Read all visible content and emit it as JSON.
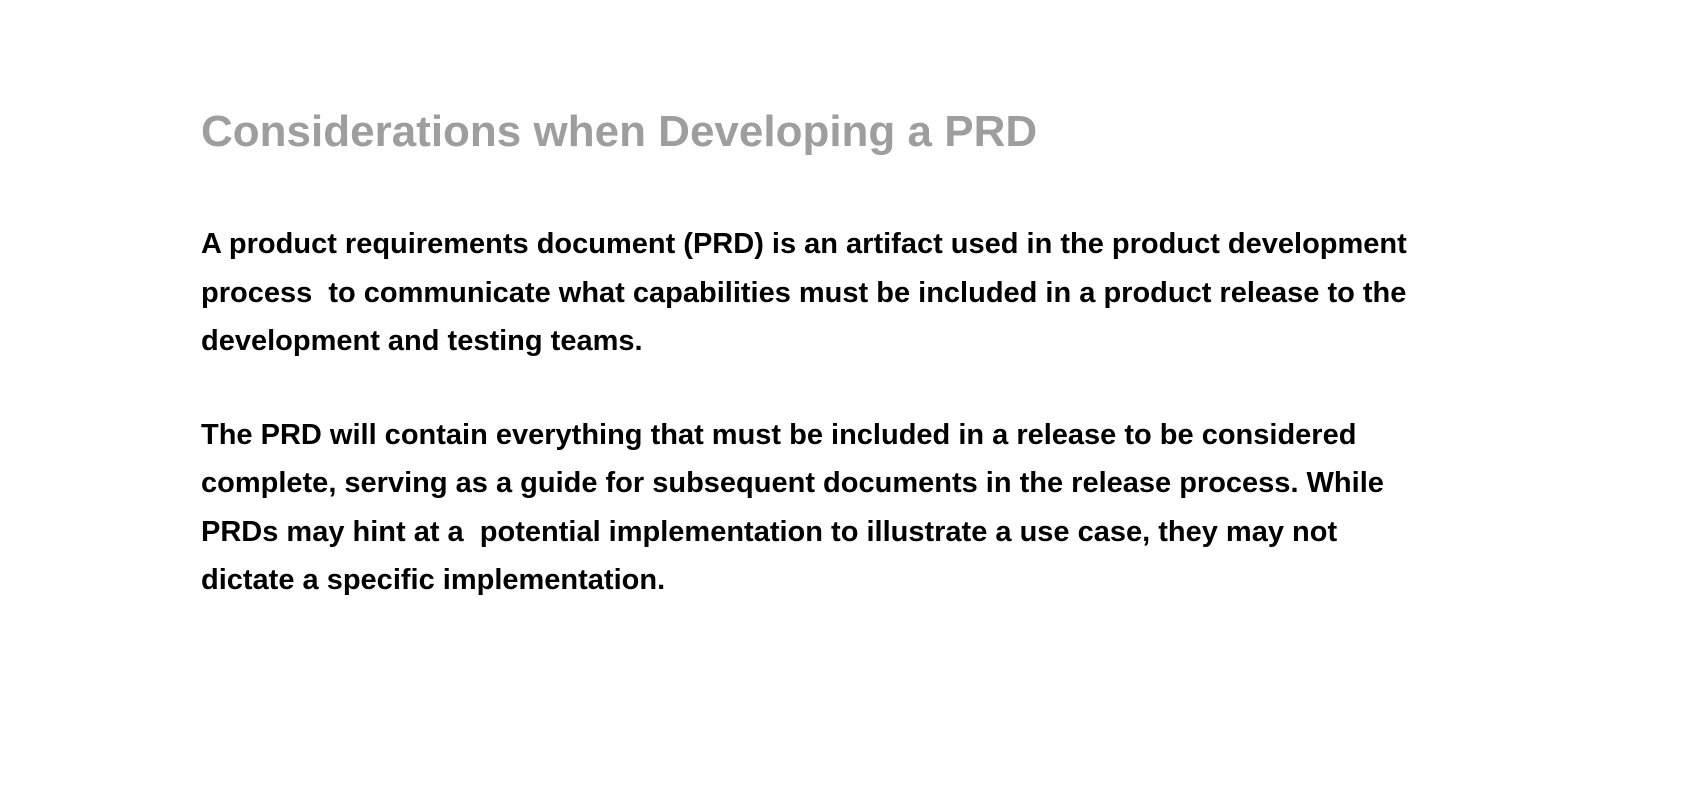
{
  "slide": {
    "title": "Considerations when Developing a PRD",
    "paragraphs": [
      {
        "lines": [
          "A product requirements document (PRD) is an artifact used in the product development",
          "process  to communicate what capabilities must be included in a product release to the",
          "development and testing teams."
        ]
      },
      {
        "lines": [
          "The PRD will contain everything that must be included in a release to be considered",
          "complete, serving as a guide for subsequent documents in the release process. While",
          "PRDs may hint at a  potential implementation to illustrate a use case, they may not",
          "dictate a specific implementation."
        ]
      }
    ]
  },
  "colors": {
    "title": "#9e9e9e",
    "body_text": "#000000",
    "background": "#ffffff"
  }
}
